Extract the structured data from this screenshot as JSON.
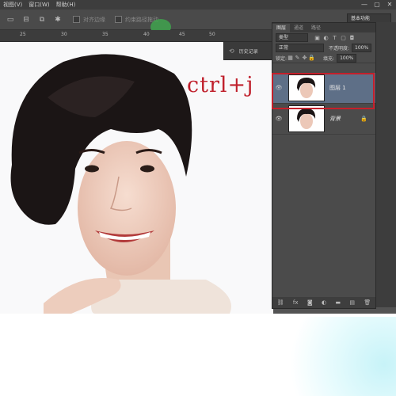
{
  "menubar": {
    "items": [
      "视图(V)",
      "窗口(W)",
      "帮助(H)"
    ],
    "window_controls": [
      "—",
      "▢",
      "✕"
    ]
  },
  "options_bar": {
    "checkbox1_label": "对齐边缘",
    "checkbox2_label": "约束路径拖动",
    "workspace": "基本功能"
  },
  "ruler": {
    "labels": [
      "25",
      "30",
      "35",
      "40",
      "45",
      "50"
    ]
  },
  "history_flyout": {
    "label": "历史记录"
  },
  "annotation": {
    "text": "ctrl+j"
  },
  "layers_panel": {
    "tabs": [
      "图层",
      "通道",
      "路径"
    ],
    "filter_kind": "类型",
    "blend_mode": "正常",
    "opacity_label": "不透明度:",
    "opacity_value": "100%",
    "lock_label": "锁定:",
    "fill_label": "填充:",
    "fill_value": "100%",
    "layers": [
      {
        "name": "图层 1",
        "selected": true,
        "locked": false
      },
      {
        "name": "背景",
        "selected": false,
        "locked": true
      }
    ]
  },
  "colors": {
    "accent_red": "#c51f2a",
    "selected_layer": "#5e6f87",
    "panel_bg": "#4b4b4b"
  }
}
